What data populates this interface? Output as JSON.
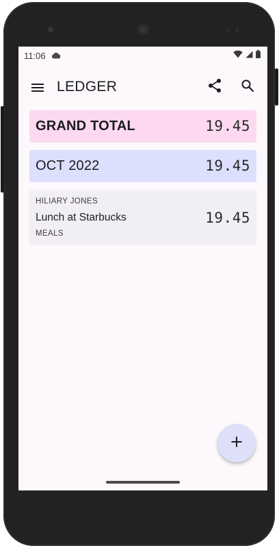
{
  "status_bar": {
    "time": "11:06"
  },
  "app_bar": {
    "title": "LEDGER",
    "icons": [
      "menu-icon",
      "share-icon",
      "search-icon"
    ]
  },
  "summary": {
    "grand_total_label": "GRAND TOTAL",
    "grand_total_amount": "19.45",
    "month_label": "OCT 2022",
    "month_amount": "19.45"
  },
  "entries": [
    {
      "person": "HILIARY JONES",
      "description": "Lunch at Starbucks",
      "category": "MEALS",
      "amount": "19.45"
    }
  ],
  "fab": {
    "icon": "add-icon"
  },
  "colors": {
    "grand_total_bg": "#fcd9f0",
    "month_bg": "#dde0fc",
    "entry_bg": "#f2eff4",
    "fab_bg": "#dee0fa",
    "screen_bg": "#fcf8fc"
  }
}
